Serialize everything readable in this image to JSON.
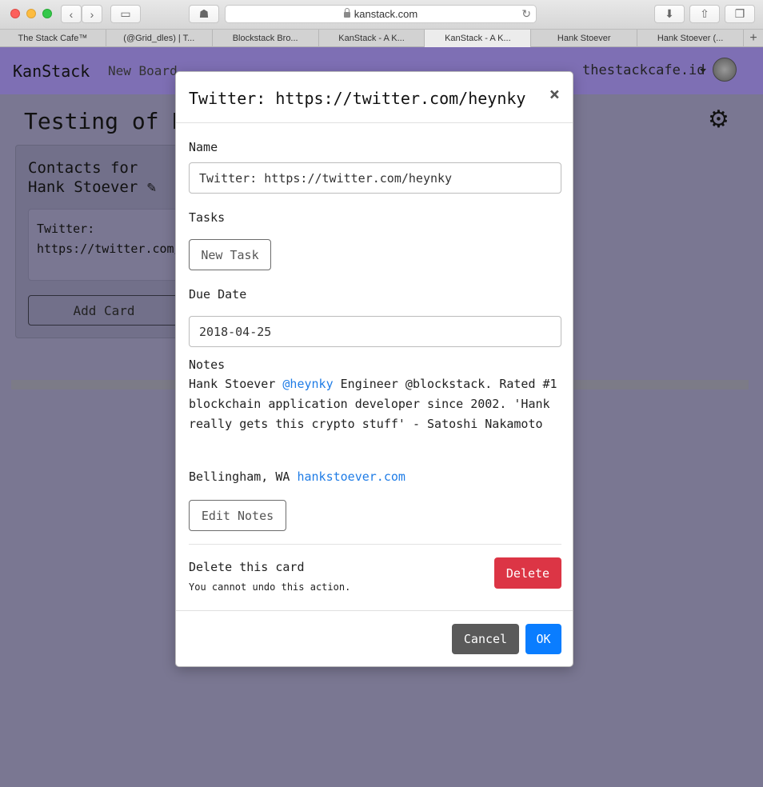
{
  "browser": {
    "url": "kanstack.com",
    "tabs": [
      {
        "label": "The Stack Cafe™"
      },
      {
        "label": "(@Grid_dles) | T..."
      },
      {
        "label": "Blockstack Bro..."
      },
      {
        "label": "KanStack - A K..."
      },
      {
        "label": "KanStack - A K..."
      },
      {
        "label": "Hank Stoever"
      },
      {
        "label": "Hank Stoever (..."
      }
    ],
    "new_tab_glyph": "+"
  },
  "app": {
    "brand": "KanStack",
    "new_board": "New Board",
    "user": "thestackcafe.id",
    "board_title": "Testing of K",
    "list": {
      "title": "Contacts for Hank Stoever",
      "card_preview": "Twitter: https://twitter.com/heynky",
      "add_card": "Add Card"
    }
  },
  "modal": {
    "title": "Twitter: https://twitter.com/heynky",
    "close_glyph": "×",
    "name_label": "Name",
    "name_value": "Twitter: https://twitter.com/heynky",
    "tasks_label": "Tasks",
    "new_task": "New Task",
    "due_label": "Due Date",
    "due_value": "2018-04-25",
    "notes_label": "Notes",
    "notes": {
      "p1_a": "Hank Stoever ",
      "p1_link": "@heynky",
      "p1_b": " Engineer @blockstack. Rated #1 blockchain application developer since 2002. 'Hank really gets this crypto stuff' - Satoshi Nakamoto",
      "p2_a": "Bellingham, WA ",
      "p2_link": "hankstoever.com"
    },
    "edit_notes": "Edit Notes",
    "delete_title": "Delete this card",
    "delete_sub": "You cannot undo this action.",
    "delete": "Delete",
    "cancel": "Cancel",
    "ok": "OK"
  }
}
